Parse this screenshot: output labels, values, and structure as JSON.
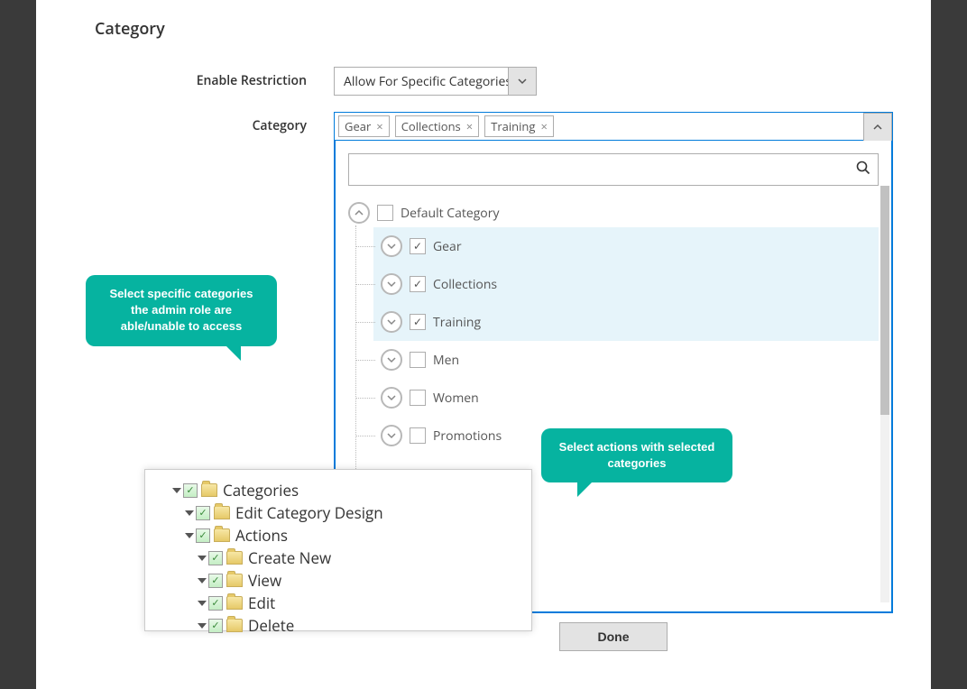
{
  "page": {
    "title": "Category"
  },
  "fields": {
    "enable_restriction_label": "Enable Restriction",
    "enable_restriction_value": "Allow For Specific Categories",
    "category_label": "Category"
  },
  "tags": {
    "items": [
      {
        "label": "Gear"
      },
      {
        "label": "Collections"
      },
      {
        "label": "Training"
      }
    ]
  },
  "search": {
    "placeholder": ""
  },
  "tree": {
    "root_label": "Default Category",
    "children": [
      {
        "label": "Gear",
        "checked": true
      },
      {
        "label": "Collections",
        "checked": true
      },
      {
        "label": "Training",
        "checked": true
      },
      {
        "label": "Men",
        "checked": false
      },
      {
        "label": "Women",
        "checked": false
      },
      {
        "label": "Promotions",
        "checked": false
      }
    ]
  },
  "done": {
    "label": "Done"
  },
  "bubbles": {
    "b1": "Select specific categories the admin role are able/unable to access",
    "b2": "Select actions with selected categories"
  },
  "permissions": {
    "items": [
      {
        "label": "Categories",
        "indent": 0
      },
      {
        "label": "Edit Category Design",
        "indent": 1
      },
      {
        "label": "Actions",
        "indent": 1
      },
      {
        "label": "Create New",
        "indent": 2
      },
      {
        "label": "View",
        "indent": 2
      },
      {
        "label": "Edit",
        "indent": 2
      },
      {
        "label": "Delete",
        "indent": 2
      }
    ]
  }
}
